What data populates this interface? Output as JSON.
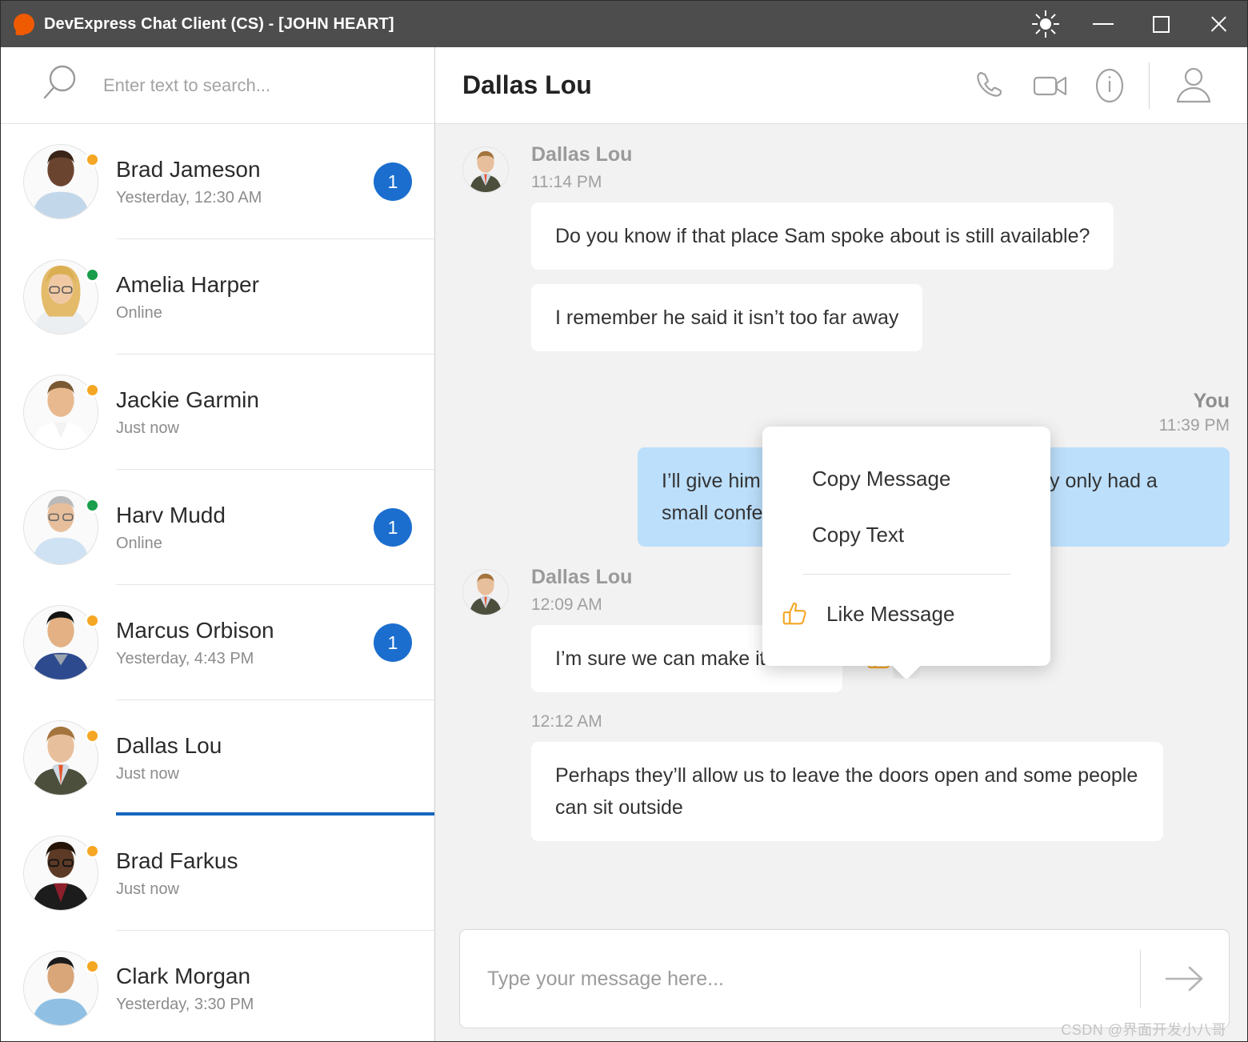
{
  "window": {
    "title": "DevExpress Chat Client (CS) - [JOHN HEART]",
    "logo_icon": "devexpress-logo-icon",
    "controls": {
      "theme_icon": "sun-icon",
      "minimize_icon": "minimize-icon",
      "maximize_icon": "maximize-icon",
      "close_icon": "close-icon"
    }
  },
  "sidebar": {
    "search": {
      "icon": "search-icon",
      "placeholder": "Enter text to search...",
      "value": ""
    },
    "contacts": [
      {
        "name": "Brad Jameson",
        "sub": "Yesterday, 12:30 AM",
        "status": "away",
        "badge": "1",
        "selected": false
      },
      {
        "name": "Amelia Harper",
        "sub": "Online",
        "status": "online",
        "badge": "",
        "selected": false
      },
      {
        "name": "Jackie Garmin",
        "sub": "Just now",
        "status": "away",
        "badge": "",
        "selected": false
      },
      {
        "name": "Harv Mudd",
        "sub": "Online",
        "status": "online",
        "badge": "1",
        "selected": false
      },
      {
        "name": "Marcus Orbison",
        "sub": "Yesterday, 4:43 PM",
        "status": "away",
        "badge": "1",
        "selected": false
      },
      {
        "name": "Dallas Lou",
        "sub": "Just now",
        "status": "away",
        "badge": "",
        "selected": true
      },
      {
        "name": "Brad Farkus",
        "sub": "Just now",
        "status": "away",
        "badge": "",
        "selected": false
      },
      {
        "name": "Clark Morgan",
        "sub": "Yesterday, 3:30 PM",
        "status": "away",
        "badge": "",
        "selected": false
      }
    ]
  },
  "chat": {
    "title": "Dallas Lou",
    "actions": {
      "call_icon": "phone-icon",
      "video_icon": "video-camera-icon",
      "info_icon": "info-circle-icon",
      "profile_icon": "person-icon"
    },
    "messages": [
      {
        "sender": "Dallas Lou",
        "time": "11:14 PM",
        "side": "left",
        "texts": [
          "Do you know if that place Sam spoke about is still available?",
          "I remember he said it isn’t too far away"
        ]
      },
      {
        "sender": "You",
        "time": "11:39 PM",
        "side": "right",
        "texts": [
          "I’ll give him a call and see, I hope not as they only had a small conference room"
        ]
      },
      {
        "sender": "Dallas Lou",
        "time": "12:09 AM",
        "side": "left",
        "liked": true,
        "texts": [
          "I’m sure we can make it work!"
        ]
      },
      {
        "sender": "",
        "time": "12:12 AM",
        "side": "left",
        "texts": [
          "Perhaps they’ll allow us to leave the doors open and some people can sit outside"
        ]
      }
    ],
    "context_menu": {
      "items": [
        {
          "label": "Copy Message",
          "icon": ""
        },
        {
          "label": "Copy Text",
          "icon": ""
        },
        {
          "label": "Like Message",
          "icon": "thumbs-up-icon"
        }
      ]
    },
    "reaction_icon": "thumbs-up-icon",
    "composer": {
      "placeholder": "Type your message here...",
      "value": "",
      "send_icon": "arrow-right-icon"
    }
  },
  "watermark": "CSDN @界面开发小八哥",
  "colors": {
    "titlebar": "#4d4d4d",
    "accent_blue": "#1b6ece",
    "bubble_you": "#bcdffb",
    "bubble_other": "#ffffff",
    "chat_bg": "#f2f2f2",
    "status_away": "#f5a623",
    "status_online": "#1a9e4b",
    "like_orange": "#f5a623",
    "logo_orange": "#f05a00"
  }
}
